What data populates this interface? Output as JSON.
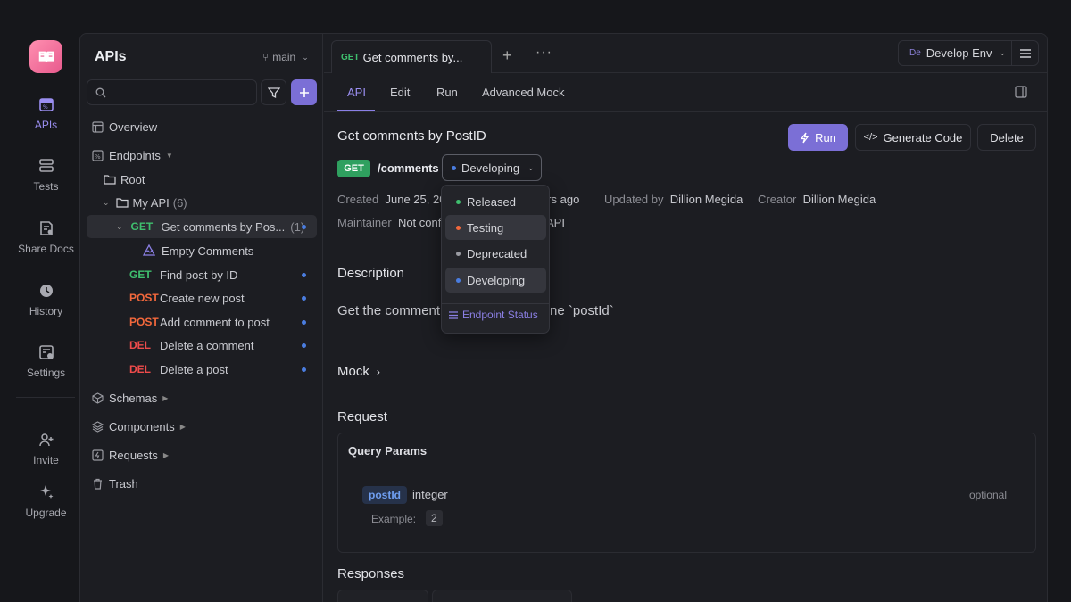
{
  "rail": {
    "items": [
      {
        "label": "APIs",
        "icon": "api-icon",
        "active": true
      },
      {
        "label": "Tests",
        "icon": "tests-icon"
      },
      {
        "label": "Share Docs",
        "icon": "share-docs-icon"
      },
      {
        "label": "History",
        "icon": "history-icon"
      },
      {
        "label": "Settings",
        "icon": "settings-icon"
      },
      {
        "label": "Invite",
        "icon": "invite-icon"
      },
      {
        "label": "Upgrade",
        "icon": "upgrade-icon"
      }
    ]
  },
  "sidebar": {
    "title": "APIs",
    "branch": "main",
    "search_placeholder": "",
    "tree": {
      "overview": "Overview",
      "endpoints": "Endpoints",
      "root": "Root",
      "folder": {
        "name": "My API",
        "count": "(6)"
      },
      "endpoints_list": [
        {
          "method": "GET",
          "name": "Get comments by Pos...",
          "count": "(1)"
        },
        {
          "method": "",
          "name": "Empty Comments"
        },
        {
          "method": "GET",
          "name": "Find post by ID"
        },
        {
          "method": "POST",
          "name": "Create new post"
        },
        {
          "method": "POST",
          "name": "Add comment to post"
        },
        {
          "method": "DEL",
          "name": "Delete a comment"
        },
        {
          "method": "DEL",
          "name": "Delete a post"
        }
      ],
      "schemas": "Schemas",
      "components": "Components",
      "requests": "Requests",
      "trash": "Trash"
    }
  },
  "tabs": {
    "doc_tab": {
      "method": "GET",
      "title": "Get comments by..."
    },
    "env": {
      "badge": "De",
      "label": "Develop Env"
    }
  },
  "subtabs": [
    "API",
    "Edit",
    "Run",
    "Advanced Mock"
  ],
  "endpoint": {
    "title": "Get comments by PostID",
    "method": "GET",
    "path": "/comments",
    "status": "Developing",
    "run_label": "Run",
    "generate_label": "Generate Code",
    "delete_label": "Delete",
    "meta": {
      "created_k": "Created",
      "created_v": "June 25, 20",
      "hours_ago": "urs ago",
      "updated_k": "Updated by",
      "updated_v": "Dillion Megida",
      "creator_k": "Creator",
      "creator_v": "Dillion Megida",
      "maintainer_k": "Maintainer",
      "maintainer_v": "Not confi",
      "api_tail": "API"
    },
    "description_heading": "Description",
    "description_text_a": "Get the comment",
    "description_text_b": "ne `postId`",
    "mock_heading": "Mock",
    "request_heading": "Request",
    "query_params_heading": "Query Params",
    "param": {
      "name": "postId",
      "type": "integer",
      "optional": "optional",
      "example_label": "Example:",
      "example_value": "2"
    },
    "responses_heading": "Responses"
  },
  "status_dropdown": {
    "options": [
      {
        "label": "Released",
        "color": "#3fbf6e"
      },
      {
        "label": "Testing",
        "color": "#f2683c"
      },
      {
        "label": "Deprecated",
        "color": "#9a9ba2"
      },
      {
        "label": "Developing",
        "color": "#4a7de0"
      }
    ],
    "footer": "Endpoint Status"
  }
}
